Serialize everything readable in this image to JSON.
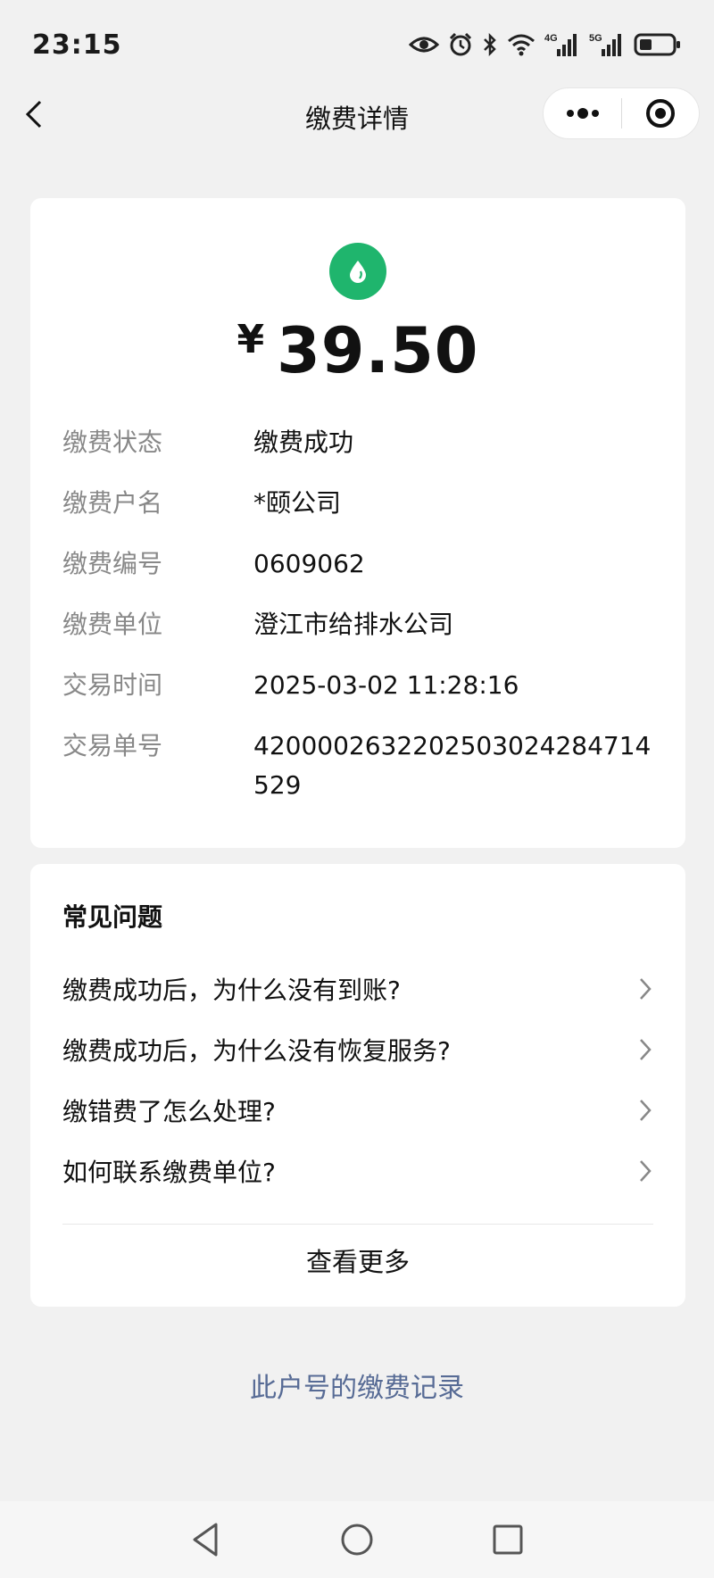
{
  "status_bar": {
    "time": "23:15",
    "signal_4g": "4G",
    "signal_5g": "5G",
    "icons": [
      "eye-icon",
      "alarm-icon",
      "bluetooth-icon",
      "wifi-icon",
      "signal-4g-icon",
      "signal-5g-icon",
      "battery-icon"
    ]
  },
  "nav": {
    "title": "缴费详情",
    "back_icon": "chevron-left-icon",
    "more_icon": "more-dots-icon",
    "close_icon": "target-close-icon"
  },
  "payment": {
    "icon": "water-drop-icon",
    "currency": "¥",
    "amount": "39.50",
    "accent_color": "#1fb56d",
    "rows": [
      {
        "label": "缴费状态",
        "value": "缴费成功"
      },
      {
        "label": "缴费户名",
        "value": "*颐公司"
      },
      {
        "label": "缴费编号",
        "value": "0609062"
      },
      {
        "label": "缴费单位",
        "value": "澄江市给排水公司"
      },
      {
        "label": "交易时间",
        "value": "2025-03-02 11:28:16"
      },
      {
        "label": "交易单号",
        "value": "4200002632202503024284714529"
      }
    ]
  },
  "faq": {
    "title": "常见问题",
    "items": [
      {
        "label": "缴费成功后，为什么没有到账?"
      },
      {
        "label": "缴费成功后，为什么没有恢复服务?"
      },
      {
        "label": "缴错费了怎么处理?"
      },
      {
        "label": "如何联系缴费单位?"
      }
    ],
    "more_label": "查看更多"
  },
  "record_link": {
    "label": "此户号的缴费记录",
    "color": "#576b95"
  },
  "system_nav": {
    "icons": [
      "back-triangle-icon",
      "home-circle-icon",
      "recents-square-icon"
    ]
  }
}
